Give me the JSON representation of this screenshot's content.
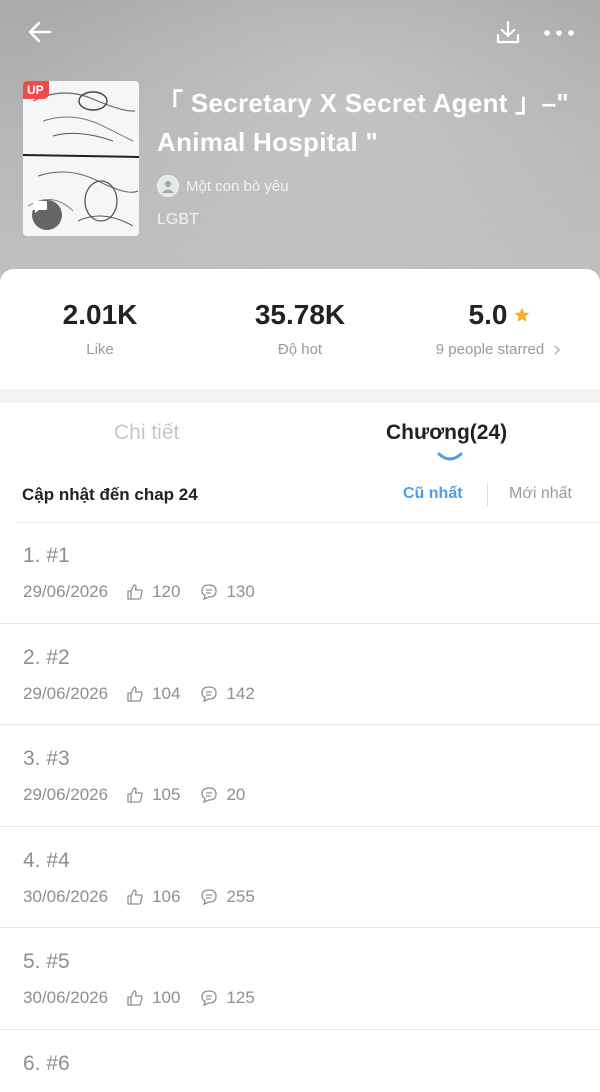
{
  "header": {
    "title": "「 Secretary X Secret Agent 」–\" Animal Hospital \"",
    "badge": "UP",
    "author": "Một con bò yêu",
    "genre": "LGBT"
  },
  "stats": {
    "likes_value": "2.01K",
    "likes_label": "Like",
    "hot_value": "35.78K",
    "hot_label": "Độ hot",
    "rating_value": "5.0",
    "rating_label": "9 people starred"
  },
  "tabs": {
    "detail": "Chi tiết",
    "chapters": "Chương(24)"
  },
  "update_bar": {
    "text": "Cập nhật đến chap 24",
    "sort_oldest": "Cũ nhất",
    "sort_newest": "Mới nhất"
  },
  "chapters": [
    {
      "title": "1. #1",
      "date": "29/06/2026",
      "likes": "120",
      "comments": "130"
    },
    {
      "title": "2. #2",
      "date": "29/06/2026",
      "likes": "104",
      "comments": "142"
    },
    {
      "title": "3. #3",
      "date": "29/06/2026",
      "likes": "105",
      "comments": "20"
    },
    {
      "title": "4. #4",
      "date": "30/06/2026",
      "likes": "106",
      "comments": "255"
    },
    {
      "title": "5. #5",
      "date": "30/06/2026",
      "likes": "100",
      "comments": "125"
    },
    {
      "title": "6. #6",
      "date": "",
      "likes": "",
      "comments": ""
    }
  ],
  "colors": {
    "accent": "#4a9fe8",
    "star": "#f5b223",
    "badge": "#f04a4a"
  }
}
